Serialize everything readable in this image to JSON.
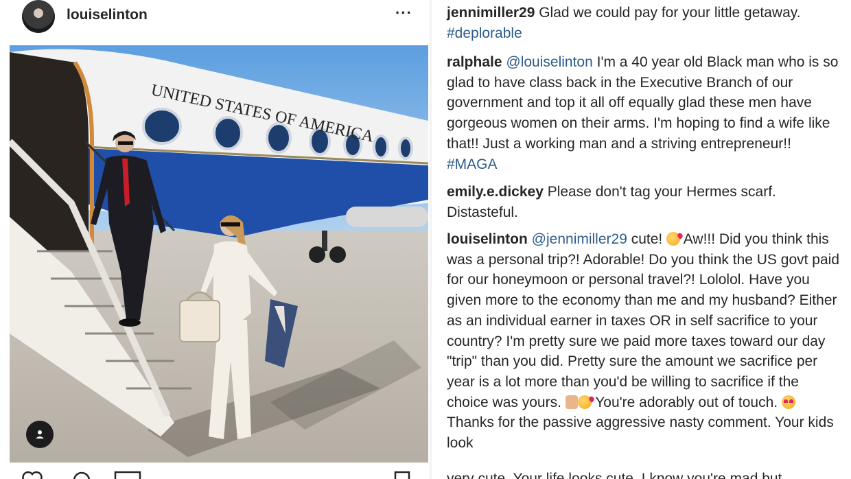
{
  "post": {
    "username": "louiselinton",
    "more_label": "···",
    "photo": {
      "plane_text": "UNITED STATES OF AMERICA",
      "alt": "Couple descending stairs of a blue and white government jet"
    },
    "user_tag_icon": "person-icon",
    "actions": [
      "heart-icon",
      "comment-icon",
      "share-icon",
      "bookmark-icon"
    ]
  },
  "comments": [
    {
      "user": "jennimiller29",
      "parts": [
        {
          "t": "text",
          "v": " Glad we could pay for your little getaway. "
        },
        {
          "t": "hashtag",
          "v": "#deplorable"
        }
      ]
    },
    {
      "user": "ralphale",
      "parts": [
        {
          "t": "text",
          "v": " "
        },
        {
          "t": "mention",
          "v": "@louiselinton"
        },
        {
          "t": "text",
          "v": " I'm a 40 year old Black man who is so glad to have class back in the Executive Branch of our government and top it all off equally glad these men have gorgeous women on their arms. I'm hoping to find a wife like that!! Just a working man and a striving entrepreneur!! "
        },
        {
          "t": "hashtag",
          "v": "#MAGA"
        }
      ]
    },
    {
      "user": "emily.e.dickey",
      "parts": [
        {
          "t": "text",
          "v": " Please don't tag your Hermes scarf. Distasteful."
        }
      ]
    },
    {
      "user": "louiselinton",
      "parts": [
        {
          "t": "text",
          "v": " "
        },
        {
          "t": "mention",
          "v": "@jennimiller29"
        },
        {
          "t": "text",
          "v": " cute! "
        },
        {
          "t": "emoji",
          "v": "kiss"
        },
        {
          "t": "text",
          "v": " Aw!!! Did you think this was a personal trip?! Adorable! Do you think the US govt paid for our honeymoon or personal travel?! Lololol. Have you given more to the economy than me and my husband? Either as an individual earner in taxes OR in self sacrifice to your country? I'm pretty sure we paid more taxes toward our day \"trip\" than you did. Pretty sure the amount we sacrifice per year is a lot more than you'd be willing to sacrifice if the choice was yours. "
        },
        {
          "t": "emoji",
          "v": "arm"
        },
        {
          "t": "emoji",
          "v": "kiss"
        },
        {
          "t": "text",
          "v": " You're adorably out of touch. "
        },
        {
          "t": "emoji",
          "v": "heart"
        },
        {
          "t": "text",
          "v": " Thanks for the passive aggressive nasty comment. Your kids look"
        }
      ]
    }
  ],
  "cutoff_line": "very cute. Your life looks cute. I know you're mad but"
}
